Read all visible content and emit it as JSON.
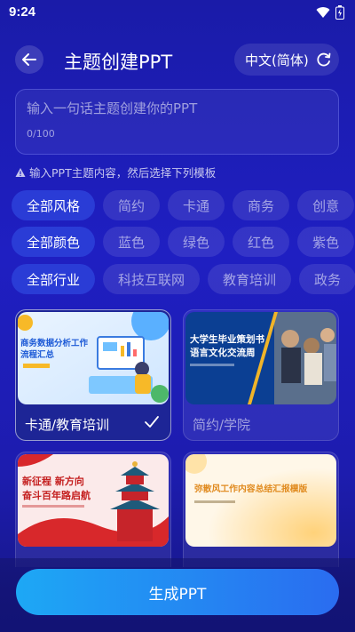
{
  "status": {
    "time": "9:24"
  },
  "header": {
    "title": "主题创建PPT",
    "language": "中文(简体)"
  },
  "input": {
    "placeholder": "输入一句话主题创建你的PPT",
    "counter": "0/100"
  },
  "hint": "输入PPT主题内容，然后选择下列模板",
  "filters": {
    "style": [
      "全部风格",
      "简约",
      "卡通",
      "商务",
      "创意"
    ],
    "color": [
      "全部颜色",
      "蓝色",
      "绿色",
      "红色",
      "紫色"
    ],
    "industry": [
      "全部行业",
      "科技互联网",
      "教育培训",
      "政务"
    ]
  },
  "templates": [
    {
      "label": "卡通/教育培训",
      "thumb_title": "商务数据分析工作流程汇总",
      "thumb_title_1": "商务数据分析工作",
      "thumb_title_2": "流程汇总",
      "selected": true
    },
    {
      "label": "简约/学院",
      "thumb_title_1": "大学生毕业策划书",
      "thumb_title_2": "语言文化交流周",
      "selected": false
    },
    {
      "label": "",
      "thumb_title_1": "新征程 新方向",
      "thumb_title_2": "奋斗百年路启航",
      "selected": false
    },
    {
      "label": "",
      "thumb_title_1": "弥散风工作内容总结汇报模版",
      "selected": false
    }
  ],
  "generate_button": "生成PPT",
  "colors": {
    "accent": "#2a3cd6",
    "button_start": "#1da8f5",
    "button_end": "#2a6cf0",
    "background": "#1f1fc2"
  }
}
